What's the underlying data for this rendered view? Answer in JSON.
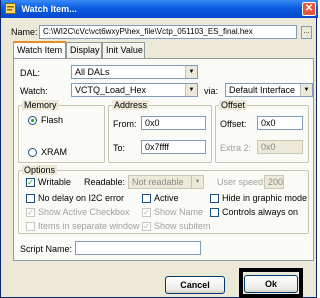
{
  "window": {
    "title": "Watch Item..."
  },
  "name_row": {
    "label": "Name:",
    "value": "C:\\WI2C\\cVc\\vct6wxyP\\hex_file\\Vctp_051103_ES_final.hex",
    "browse_label": "..."
  },
  "tabs": [
    {
      "label": "Watch Item",
      "active": true
    },
    {
      "label": "Display",
      "active": false
    },
    {
      "label": "Init Value",
      "active": false
    }
  ],
  "dal": {
    "label": "DAL:",
    "value": "All DALs"
  },
  "watch": {
    "label": "Watch:",
    "value": "VCTQ_Load_Hex",
    "via_label": "via:",
    "via_value": "Default Interface"
  },
  "memory": {
    "title": "Memory",
    "options": [
      {
        "label": "Flash",
        "selected": true
      },
      {
        "label": "XRAM",
        "selected": false
      }
    ]
  },
  "address": {
    "title": "Address",
    "from_label": "From:",
    "from_value": "0x0",
    "to_label": "To:",
    "to_value": "0x7ffff"
  },
  "offset": {
    "title": "Offset",
    "offset_label": "Offset:",
    "offset_value": "0x0",
    "extra_label": "Extra 2:",
    "extra_value": "0x0"
  },
  "options": {
    "title": "Options",
    "writable": {
      "label": "Writable",
      "checked": true
    },
    "readable_label": "Readable:",
    "readable_value": "Not readable",
    "user_speed_label": "User speed:",
    "user_speed_value": "200",
    "no_delay": {
      "label": "No delay on I2C error",
      "checked": false
    },
    "active": {
      "label": "Active",
      "checked": false
    },
    "hide_graphic": {
      "label": "Hide in graphic mode",
      "checked": false
    },
    "show_active_checkbox": {
      "label": "Show Active Checkbox",
      "checked": true
    },
    "show_name": {
      "label": "Show Name",
      "checked": true
    },
    "controls_always_on": {
      "label": "Controls always on",
      "checked": false
    },
    "items_separate": {
      "label": "Items in separate window",
      "checked": false
    },
    "show_subitem": {
      "label": "Show subitem",
      "checked": true
    }
  },
  "script_name": {
    "label": "Script Name:",
    "value": ""
  },
  "buttons": {
    "cancel": "Cancel",
    "ok": "Ok"
  }
}
